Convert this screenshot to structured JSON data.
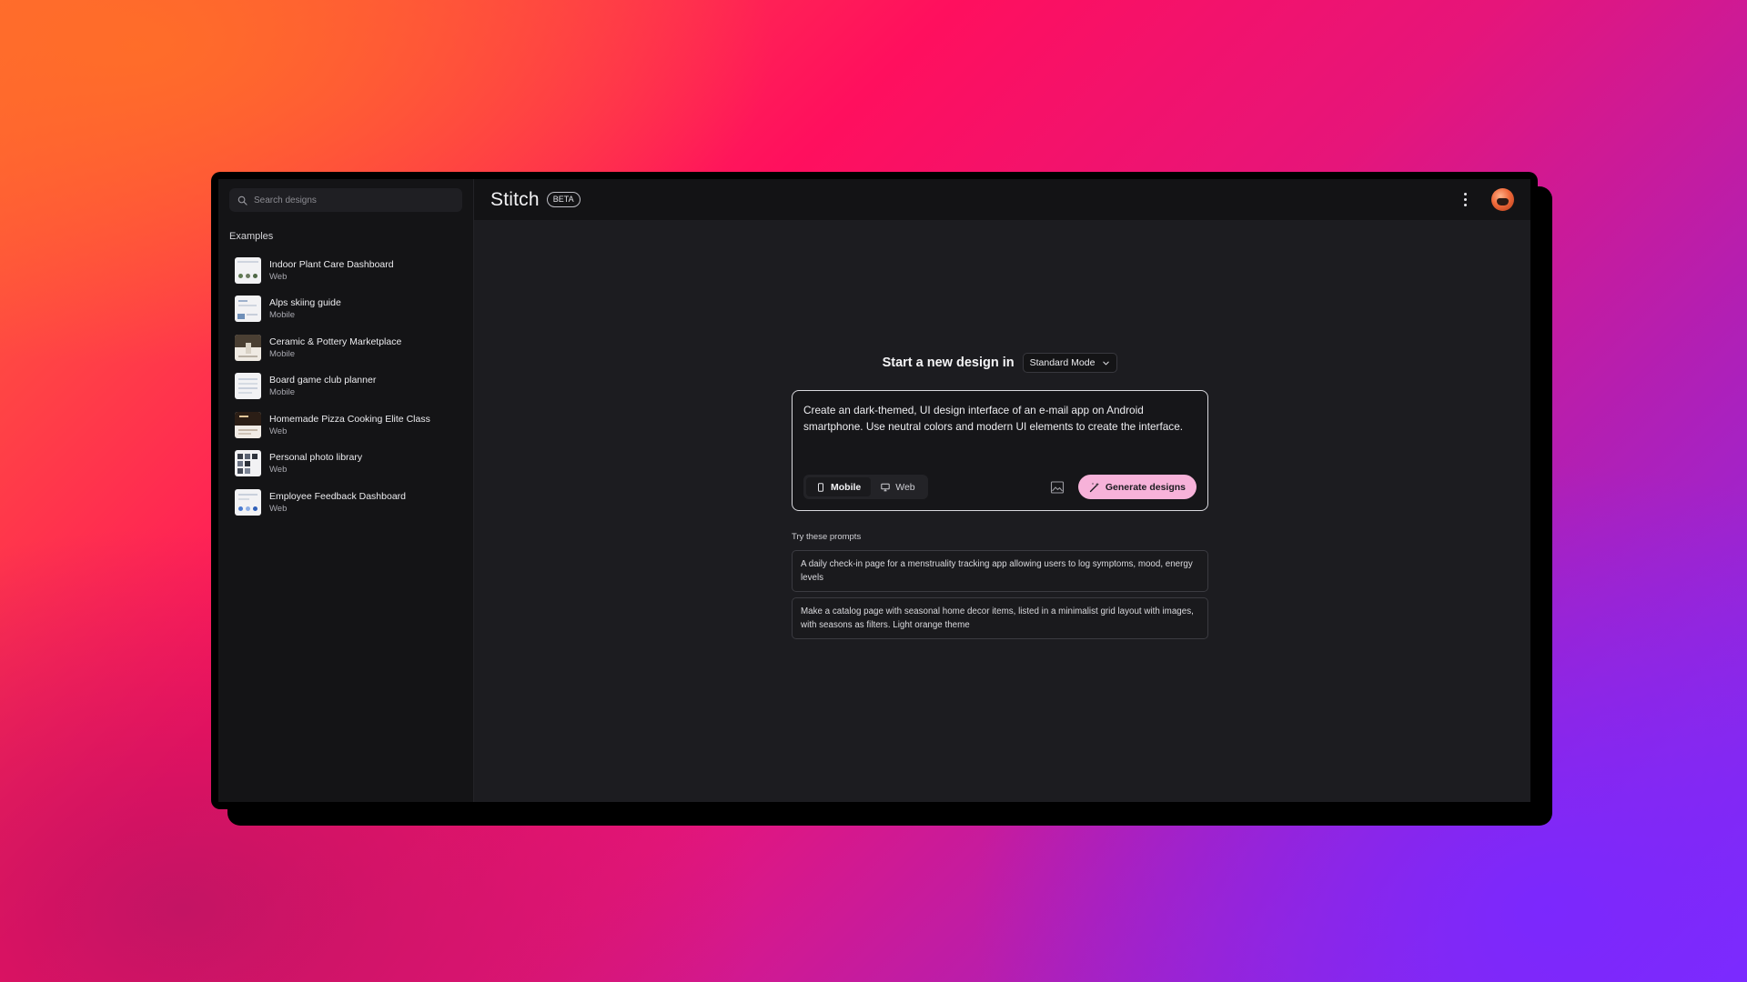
{
  "sidebar": {
    "search_placeholder": "Search designs",
    "section_title": "Examples",
    "items": [
      {
        "title": "Indoor Plant Care Dashboard",
        "type": "Web"
      },
      {
        "title": "Alps skiing guide",
        "type": "Mobile"
      },
      {
        "title": "Ceramic & Pottery Marketplace",
        "type": "Mobile"
      },
      {
        "title": "Board game club planner",
        "type": "Mobile"
      },
      {
        "title": "Homemade Pizza Cooking Elite Class",
        "type": "Web"
      },
      {
        "title": "Personal photo library",
        "type": "Web"
      },
      {
        "title": "Employee Feedback Dashboard",
        "type": "Web"
      }
    ]
  },
  "header": {
    "brand": "Stitch",
    "badge": "BETA",
    "icons": [
      "more-vertical-icon",
      "avatar"
    ]
  },
  "main": {
    "heading": "Start a new design in",
    "mode": "Standard Mode",
    "prompt": "Create an dark-themed, UI design interface of an e-mail app on Android smartphone. Use neutral colors and modern UI elements to create the interface.",
    "platforms": [
      {
        "label": "Mobile",
        "active": true
      },
      {
        "label": "Web",
        "active": false
      }
    ],
    "generate_label": "Generate designs",
    "try_title": "Try these prompts",
    "suggestions": [
      "A daily check-in page for a menstruality tracking app allowing users to log symptoms, mood, energy levels",
      "Make a catalog page with seasonal home decor items, listed in a minimalist grid layout with images, with seasons as filters. Light orange theme"
    ]
  },
  "colors": {
    "accent": "#f7b2d9",
    "app_bg": "#1c1c20",
    "sidebar_bg": "#141416"
  }
}
